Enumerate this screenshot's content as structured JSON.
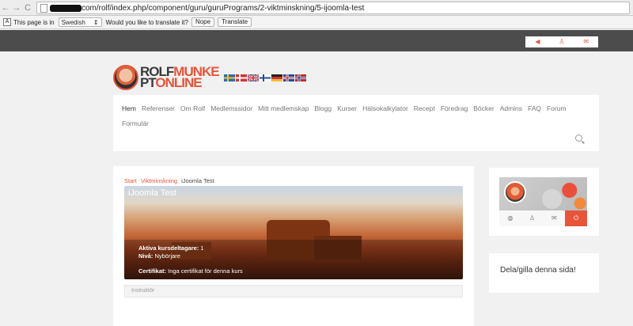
{
  "browser": {
    "url": "com/rolf/index.php/component/guru/guruPrograms/2-viktminskning/5-ijoomla-test",
    "translate_prefix": "This page is in",
    "translate_language": "Swedish",
    "translate_question": "Would you like to translate it?",
    "translate_nope": "Nope",
    "translate_translate": "Translate"
  },
  "logo": {
    "line1_dark": "ROLF",
    "line1_red": "MUNKE",
    "line2_dark": "PT",
    "line2_red": "ONLINE"
  },
  "nav": {
    "row1": [
      "Hem",
      "Referenser",
      "Om Rolf",
      "Medlemssidor",
      "Mitt medlemskap",
      "Blogg",
      "Kurser",
      "Hälsokalkylator",
      "Recept",
      "Föredrag",
      "Böcker",
      "Admins",
      "FAQ",
      "Forum"
    ],
    "row2": [
      "Formulär"
    ]
  },
  "breadcrumb": {
    "start": "Start",
    "section": "Viktminskning",
    "current": "iJoomla Test"
  },
  "course": {
    "title": "iJoomla Test",
    "active_label": "Aktiva kursdeltagare:",
    "active_value": "1",
    "level_label": "Nivå:",
    "level_value": "Nybörjare",
    "cert_label": "Certifikat:",
    "cert_value": "Inga certifikat för denna kurs",
    "instructor_tab": "Instruktör"
  },
  "sidebar": {
    "share_title": "Dela/gilla denna sida!"
  },
  "colors": {
    "accent": "#e8543a",
    "topbar": "#4c4c4c"
  },
  "icons": [
    "globe-icon",
    "users-icon",
    "mail-icon",
    "power-icon",
    "search-icon"
  ]
}
